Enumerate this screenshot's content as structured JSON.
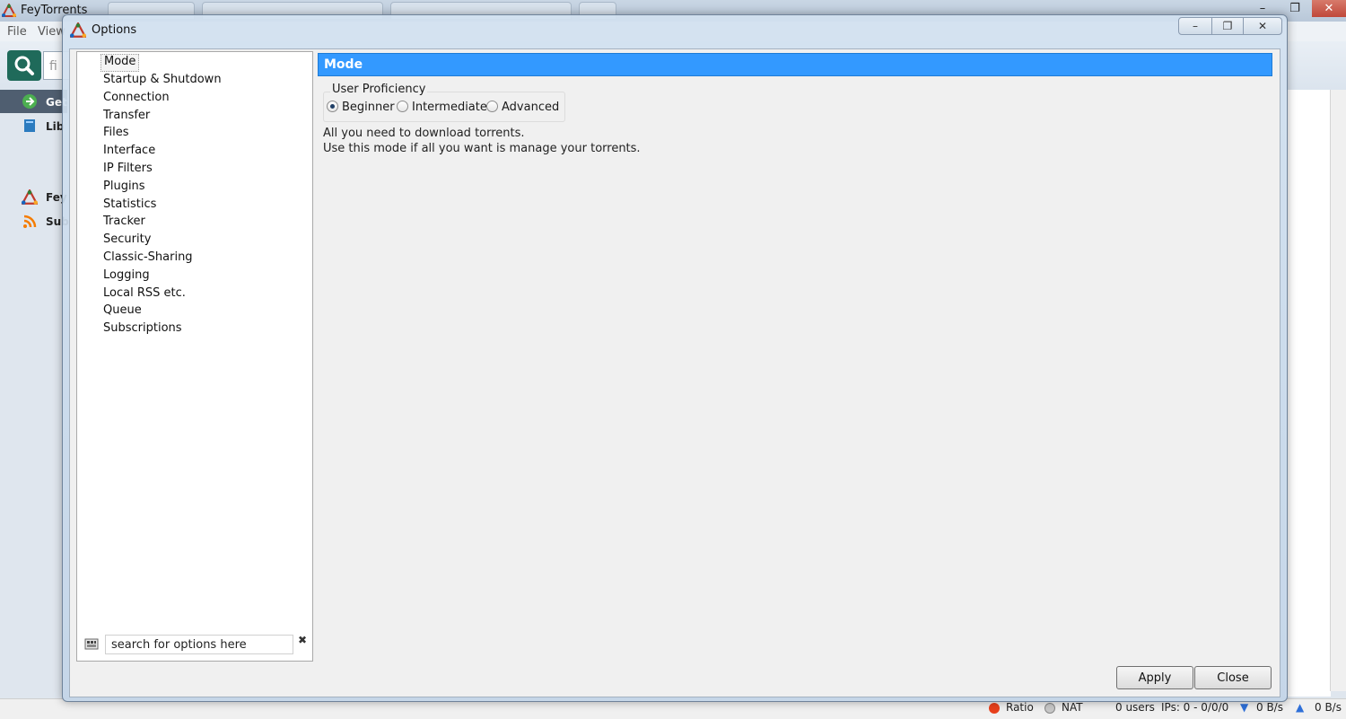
{
  "app": {
    "title": "FeyTorrents",
    "menus": [
      "File",
      "View"
    ],
    "search_placeholder": "fi",
    "sidebar": [
      {
        "label": "Get",
        "icon": "arrow-right-icon"
      },
      {
        "label": "Lib",
        "icon": "library-icon"
      },
      {
        "label": "Fey",
        "icon": "feytorrents-logo-icon"
      },
      {
        "label": "Sub",
        "icon": "rss-icon"
      }
    ],
    "window_buttons": [
      "–",
      "❐",
      "✕"
    ]
  },
  "dialog": {
    "title": "Options",
    "window_buttons": [
      "–",
      "❐",
      "✕"
    ],
    "tree": [
      "Mode",
      "Startup & Shutdown",
      "Connection",
      "Transfer",
      "Files",
      "Interface",
      "IP Filters",
      "Plugins",
      "Statistics",
      "Tracker",
      "Security",
      "Classic-Sharing",
      "Logging",
      "Local RSS etc.",
      "Queue",
      "Subscriptions"
    ],
    "selected_tree_item": "Mode",
    "search_placeholder": "search for options here",
    "search_clear": "✖",
    "section_title": "Mode",
    "proficiency": {
      "label": "User Proficiency",
      "options": [
        "Beginner",
        "Intermediate",
        "Advanced"
      ],
      "selected": "Beginner"
    },
    "description": [
      "All you need to download torrents.",
      "Use this mode if all you want is manage your torrents."
    ],
    "buttons": {
      "apply": "Apply",
      "close": "Close"
    }
  },
  "statusbar": {
    "ratio": "Ratio",
    "nat": "NAT",
    "users": "0 users",
    "ips": "IPs: 0 - 0/0/0",
    "down": "0 B/s",
    "up": "0 B/s",
    "colors": {
      "ratio": "#e8401c",
      "nat": "#a0a0a0",
      "down": "#2e6fd8",
      "up": "#2e6fd8"
    }
  },
  "colors": {
    "selection_header": "#3399ff",
    "dialog_frame": "#c3d5e8"
  }
}
